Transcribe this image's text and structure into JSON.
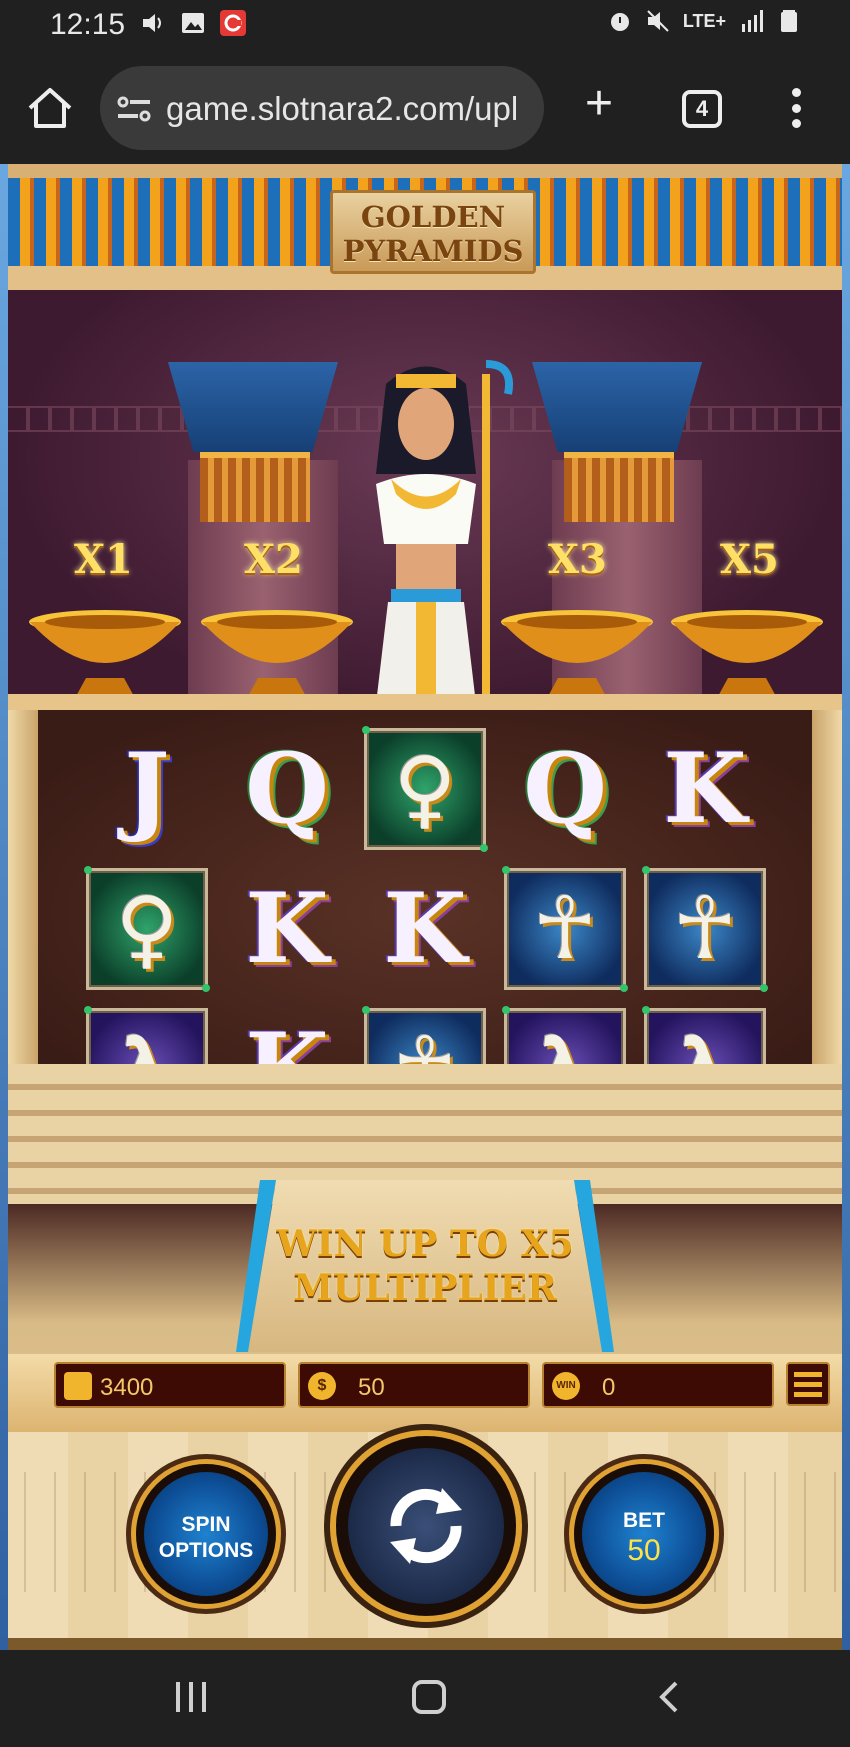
{
  "status_bar": {
    "time": "12:15",
    "left_icons": [
      "volume-icon",
      "image-icon",
      "app-c-icon"
    ],
    "right_icons": [
      "alarm-icon",
      "mute-icon",
      "lte-icon",
      "signal-icon",
      "battery-icon"
    ],
    "network": "LTE+"
  },
  "browser": {
    "url": "game.slotnara2.com/upl",
    "tab_count": "4"
  },
  "game": {
    "title_line1": "GOLDEN",
    "title_line2": "PYRAMIDS",
    "multipliers": [
      "X1",
      "X2",
      "X3",
      "X5"
    ],
    "reels": [
      [
        "J",
        "Q",
        "key",
        "Q",
        "K"
      ],
      [
        "key",
        "K",
        "K",
        "ankh",
        "ankh"
      ],
      [
        "eye",
        "K",
        "ankh",
        "eye",
        "eye"
      ]
    ],
    "promo_line1": "WIN UP TO X5",
    "promo_line2": "MULTIPLIER",
    "balance": "3400",
    "bet_display": "50",
    "win": "0",
    "win_badge": "WIN",
    "coin_badge": "$",
    "spin_options_line1": "SPIN",
    "spin_options_line2": "OPTIONS",
    "bet_label": "BET",
    "bet_value": "50",
    "colors": {
      "accent_gold": "#f0b52c",
      "button_blue": "#1f82d0",
      "panel_dark": "#3e0a04"
    }
  }
}
